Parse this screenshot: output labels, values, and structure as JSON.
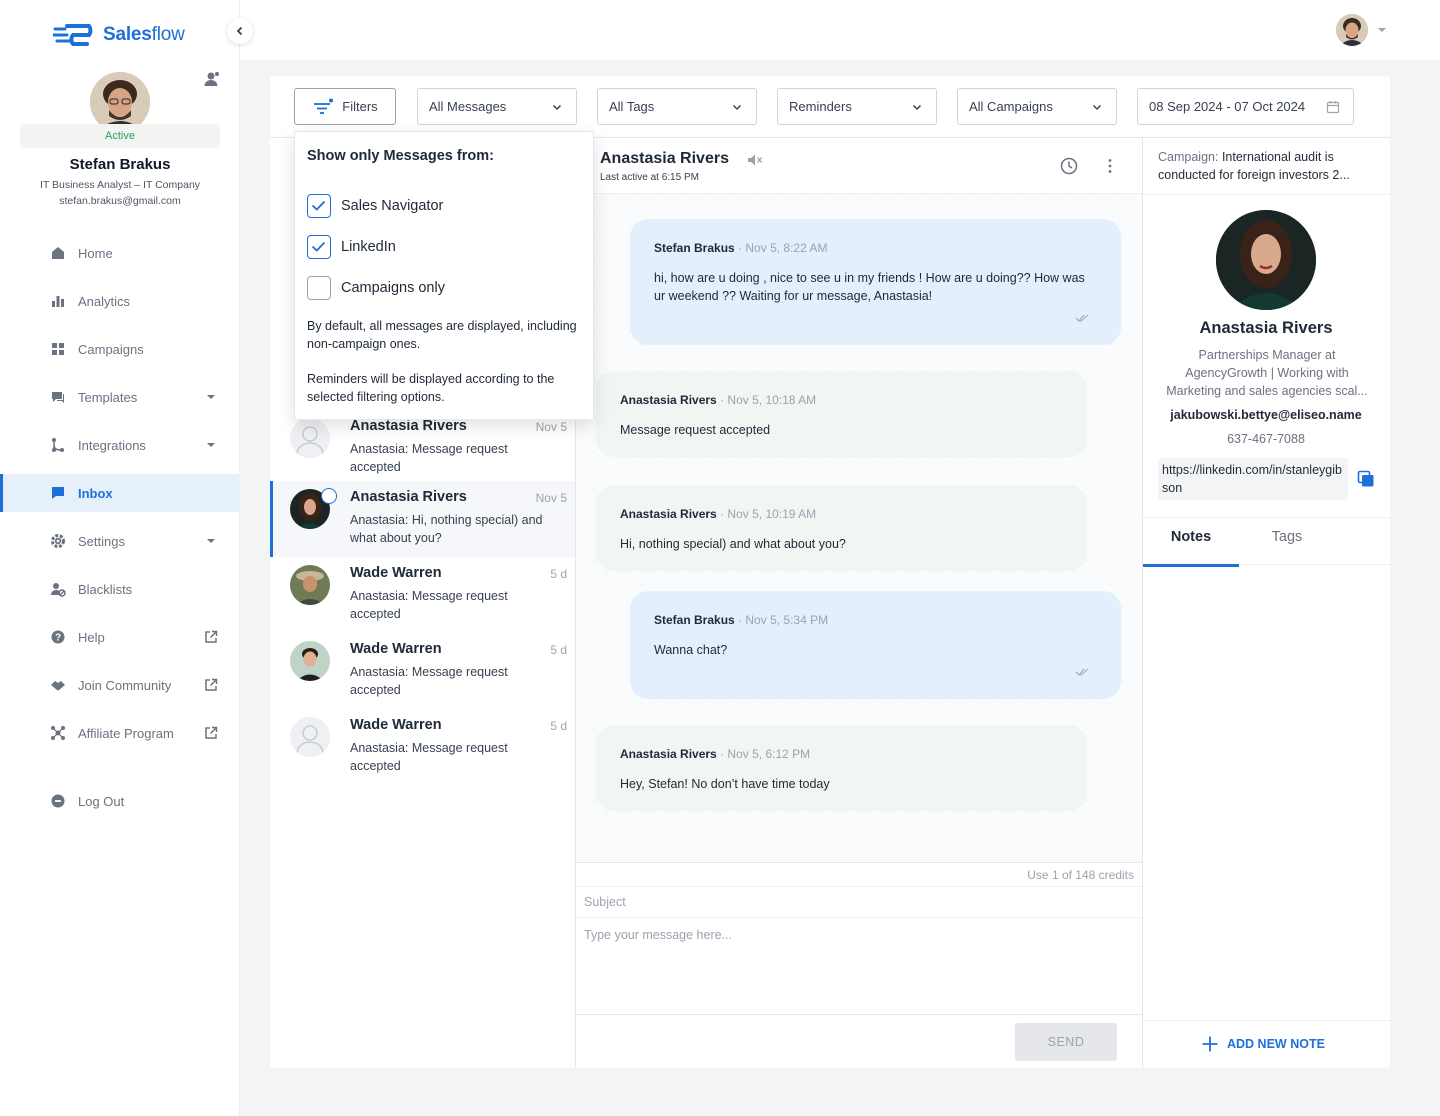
{
  "brand": {
    "name_bold": "Sales",
    "name_light": "flow",
    "accent": "#1e6fd9"
  },
  "profile": {
    "status": "Active",
    "name": "Stefan Brakus",
    "role": "IT Business Analyst – IT Company",
    "email": "stefan.brakus@gmail.com"
  },
  "nav": {
    "items": [
      {
        "label": "Home",
        "icon": "home-icon"
      },
      {
        "label": "Analytics",
        "icon": "analytics-icon"
      },
      {
        "label": "Campaigns",
        "icon": "campaigns-icon"
      },
      {
        "label": "Templates",
        "icon": "templates-icon",
        "trail": "chevron-down-icon"
      },
      {
        "label": "Integrations",
        "icon": "integrations-icon",
        "trail": "chevron-down-icon"
      },
      {
        "label": "Inbox",
        "icon": "inbox-icon",
        "active": true
      },
      {
        "label": "Settings",
        "icon": "settings-icon",
        "trail": "chevron-down-icon"
      },
      {
        "label": "Blacklists",
        "icon": "blacklists-icon"
      },
      {
        "label": "Help",
        "icon": "help-icon",
        "trail": "external-link-icon"
      },
      {
        "label": "Join Community",
        "icon": "community-icon",
        "trail": "external-link-icon"
      },
      {
        "label": "Affiliate Program",
        "icon": "affiliate-icon",
        "trail": "external-link-icon"
      },
      {
        "label": "Log Out",
        "icon": "logout-icon"
      }
    ]
  },
  "filters": {
    "filters_label": "Filters",
    "messages": "All Messages",
    "tags": "All Tags",
    "reminders": "Reminders",
    "campaigns": "All Campaigns",
    "date_range": "08 Sep 2024 - 07 Oct 2024"
  },
  "dropdown": {
    "title": "Show only Messages from:",
    "options": [
      {
        "label": "Sales Navigator",
        "checked": true
      },
      {
        "label": "LinkedIn",
        "checked": true
      },
      {
        "label": "Campaigns only",
        "checked": false
      }
    ],
    "note1": "By default, all messages are displayed, including non-campaign ones.",
    "note2": "Reminders will be displayed according to the selected filtering options."
  },
  "conversations": [
    {
      "name": "Anastasia Rivers",
      "time": "Nov 5",
      "preview": "Anastasia: Message request accepted"
    },
    {
      "name": "Anastasia Rivers",
      "time": "Nov 5",
      "preview": "Anastasia: Hi, nothing special) and what about you?",
      "selected": true
    },
    {
      "name": "Wade Warren",
      "time": "5 d",
      "preview": "Anastasia: Message request accepted"
    },
    {
      "name": "Wade Warren",
      "time": "5 d",
      "preview": "Anastasia: Message request accepted"
    },
    {
      "name": "Wade Warren",
      "time": "5 d",
      "preview": "Anastasia: Message request accepted"
    }
  ],
  "chat": {
    "name": "Anastasia Rivers",
    "last_active": "Last active at 6:15 PM",
    "messages": [
      {
        "author": "Stefan Brakus",
        "time": "Nov 5, 8:22 AM",
        "text": "hi, how are u doing , nice to see u in my friends ! How are u doing?? How was ur weekend ?? Waiting for ur message, Anastasia!",
        "direction": "out"
      },
      {
        "author": "Anastasia Rivers",
        "time": "Nov 5, 10:18 AM",
        "text": "Message request accepted",
        "direction": "in"
      },
      {
        "author": "Anastasia Rivers",
        "time": "Nov 5, 10:19 AM",
        "text": "Hi, nothing special) and what about you?",
        "direction": "in"
      },
      {
        "author": "Stefan Brakus",
        "time": "Nov 5, 5:34 PM",
        "text": "Wanna chat?",
        "direction": "out"
      },
      {
        "author": "Anastasia Rivers",
        "time": "Nov 5, 6:12 PM",
        "text": "Hey, Stefan! No don’t have time today",
        "direction": "in"
      }
    ],
    "separator": "·",
    "credits": "Use 1 of 148 credits",
    "subject_placeholder": "Subject",
    "message_placeholder": "Type your message here...",
    "send_label": "SEND"
  },
  "contact": {
    "campaign_key": "Campaign:",
    "campaign_value": "International audit is conducted for foreign investors 2...",
    "name": "Anastasia Rivers",
    "title": "Partnerships Manager at AgencyGrowth | Working with Marketing and sales agencies scal...",
    "email": "jakubowski.bettye@eliseo.name",
    "phone": "637-467-7088",
    "linkedin": "https://linkedin.com/in/stanleygibson",
    "tabs": [
      "Notes",
      "Tags"
    ],
    "add_note": "ADD NEW NOTE"
  }
}
